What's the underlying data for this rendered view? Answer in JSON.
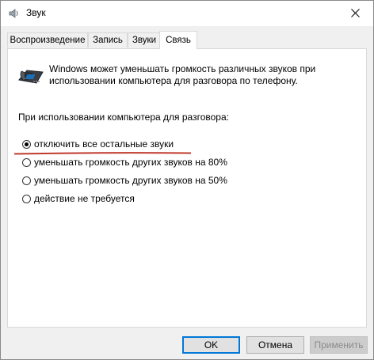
{
  "window": {
    "title": "Звук",
    "title_icon": "speaker-icon",
    "close_icon": "close-icon"
  },
  "tabs": [
    {
      "label": "Воспроизведение",
      "active": false
    },
    {
      "label": "Запись",
      "active": false
    },
    {
      "label": "Звуки",
      "active": false
    },
    {
      "label": "Связь",
      "active": true
    }
  ],
  "communications": {
    "icon": "phone-icon",
    "description": "Windows может уменьшать громкость различных звуков при использовании компьютера для разговора по телефону.",
    "group_label": "При использовании компьютера для разговора:",
    "options": [
      {
        "label": "отключить все остальные звуки",
        "checked": true
      },
      {
        "label": "уменьшать громкость других звуков на 80%",
        "checked": false
      },
      {
        "label": "уменьшать громкость других звуков на 50%",
        "checked": false
      },
      {
        "label": "действие не требуется",
        "checked": false
      }
    ],
    "highlight_color": "#c0392b"
  },
  "buttons": {
    "ok": "OK",
    "cancel": "Отмена",
    "apply": "Применить"
  },
  "colors": {
    "accent": "#0078d7",
    "disabled_text": "#8c8c8c"
  }
}
